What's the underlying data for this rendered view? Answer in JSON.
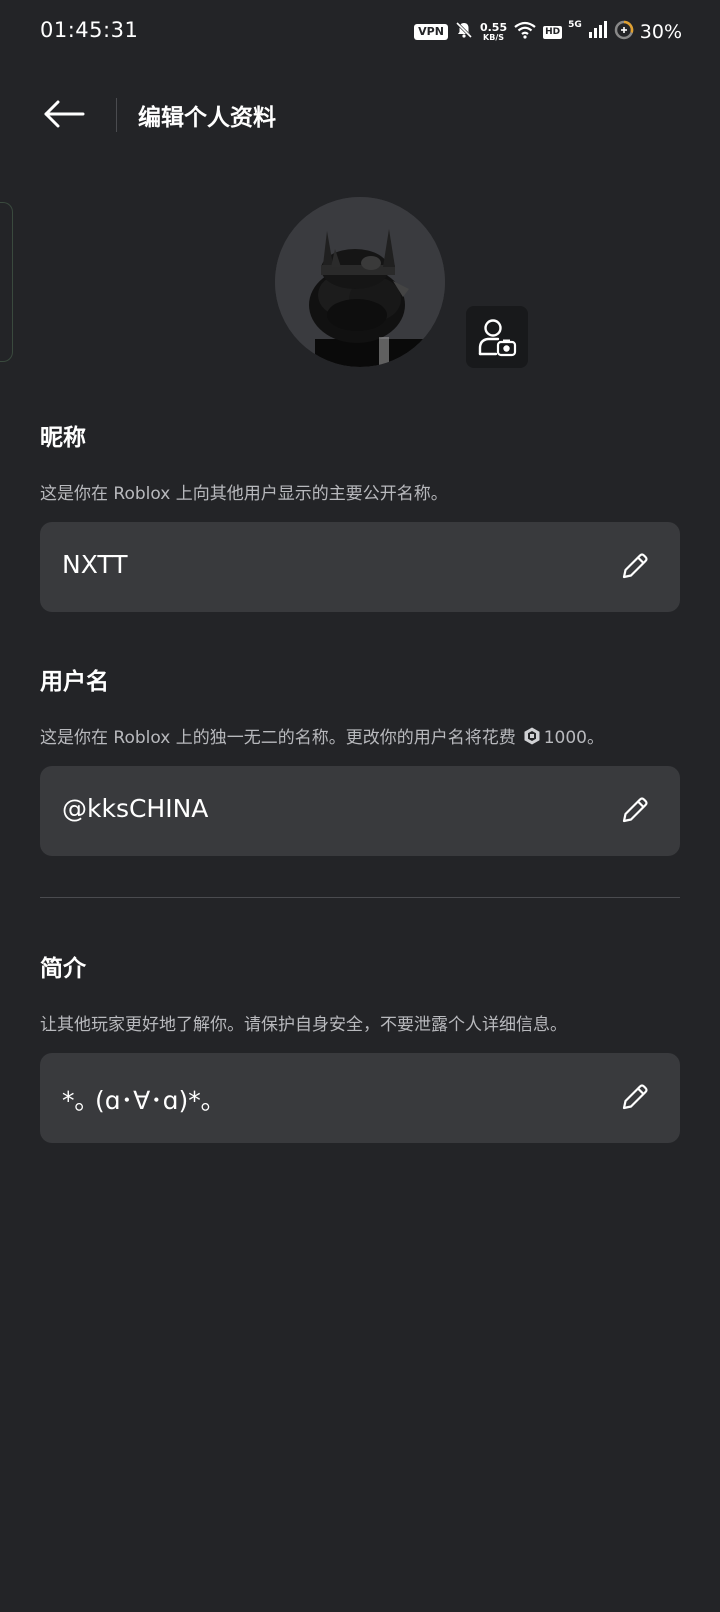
{
  "status_bar": {
    "time": "01:45:31",
    "vpn": "VPN",
    "speed_value": "0.55",
    "speed_unit": "KB/S",
    "hd": "HD",
    "network": "5G",
    "battery": "30%"
  },
  "header": {
    "title": "编辑个人资料"
  },
  "nickname": {
    "title": "昵称",
    "description": "这是你在 Roblox 上向其他用户显示的主要公开名称。",
    "value": "NXTT"
  },
  "username": {
    "title": "用户名",
    "description": "这是你在 Roblox 上的独一无二的名称。更改你的用户名将花费",
    "cost": "1000。",
    "value": "@kksCHINA"
  },
  "bio": {
    "title": "简介",
    "description": "让其他玩家更好地了解你。请保护自身安全，不要泄露个人详细信息。",
    "value": "*｡  (ɑ･∀･ɑ)*｡"
  }
}
